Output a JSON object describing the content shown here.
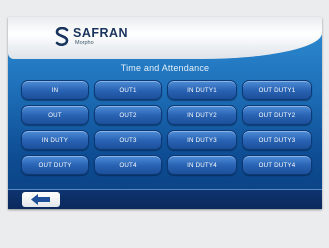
{
  "brand": {
    "name": "SAFRAN",
    "subtitle": "Morpho"
  },
  "screen_title": "Time and Attendance",
  "buttons": [
    "IN",
    "OUT1",
    "IN DUTY1",
    "OUT DUTY1",
    "OUT",
    "OUT2",
    "IN DUTY2",
    "OUT DUTY2",
    "IN DUTY",
    "OUT3",
    "IN DUTY3",
    "OUT DUTY3",
    "OUT DUTY",
    "OUT4",
    "IN DUTY4",
    "OUT DUTY4"
  ],
  "footer": {
    "back_icon": "left-arrow-icon"
  },
  "colors": {
    "panel_top": "#2f8fd6",
    "panel_bottom": "#0a3f7f",
    "button": "#2a64b4",
    "back_arrow": "#1d4f9a"
  }
}
